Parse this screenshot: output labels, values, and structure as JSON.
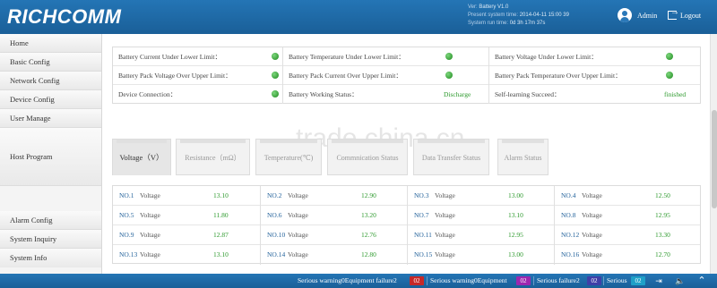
{
  "header": {
    "logo": "RICHCOMM",
    "version_label": "Ver:",
    "version_value": "Battery V1.0",
    "present_time_label": "Present system time:",
    "present_time_value": "2014-04-11 15:00 39",
    "run_time_label": "System run time:",
    "run_time_value": "0d 3h 17m 37s",
    "user_name": "Admin",
    "logout_label": "Logout"
  },
  "sidebar": {
    "items": [
      {
        "label": "Home"
      },
      {
        "label": "Basic Config"
      },
      {
        "label": "Network Config"
      },
      {
        "label": "Device Config"
      },
      {
        "label": "User Manage"
      },
      {
        "label": "Host Program"
      },
      {
        "label": "Alarm Config"
      },
      {
        "label": "System Inquiry"
      },
      {
        "label": "System Info"
      }
    ]
  },
  "status": {
    "rows": [
      [
        {
          "label": "Battery Current Under Lower Limit：",
          "indicator": "green"
        },
        {
          "label": "Battery Temperature Under Lower Limit：",
          "indicator": "green"
        },
        {
          "label": "Battery Voltage Under Lower Limit：",
          "indicator": "green"
        }
      ],
      [
        {
          "label": "Battery Pack Voltage Over Upper Limit：",
          "indicator": "green"
        },
        {
          "label": "Battery Pack Current Over Upper Limit：",
          "indicator": "green"
        },
        {
          "label": "Battery Pack Temperature Over Upper Limit：",
          "indicator": "green"
        }
      ],
      [
        {
          "label": "Device Connection：",
          "indicator": "green"
        },
        {
          "label": "Battery Working Status：",
          "value": "Discharge"
        },
        {
          "label": "Self-learning Succeed：",
          "value": "finished"
        }
      ]
    ]
  },
  "tabs": [
    {
      "label": "Voltage（V）",
      "active": true
    },
    {
      "label": "Resistance（mΩ）",
      "active": false
    },
    {
      "label": "Temperature(℃)",
      "active": false
    },
    {
      "label": "Commnication Status",
      "active": false
    },
    {
      "label": "Data Transfer Status",
      "active": false
    },
    {
      "label": "Alarm Status",
      "active": false
    }
  ],
  "voltages": [
    {
      "no": "NO.1",
      "label": "Voltage",
      "value": "13.10"
    },
    {
      "no": "NO.2",
      "label": "Voltage",
      "value": "12.90"
    },
    {
      "no": "NO.3",
      "label": "Voltage",
      "value": "13.00"
    },
    {
      "no": "NO.4",
      "label": "Voltage",
      "value": "12.50"
    },
    {
      "no": "NO.5",
      "label": "Voltage",
      "value": "11.80"
    },
    {
      "no": "NO.6",
      "label": "Voltage",
      "value": "13.20"
    },
    {
      "no": "NO.7",
      "label": "Voltage",
      "value": "13.10"
    },
    {
      "no": "NO.8",
      "label": "Voltage",
      "value": "12.95"
    },
    {
      "no": "NO.9",
      "label": "Voltage",
      "value": "12.87"
    },
    {
      "no": "NO.10",
      "label": "Voltage",
      "value": "12.76"
    },
    {
      "no": "NO.11",
      "label": "Voltage",
      "value": "12.95"
    },
    {
      "no": "NO.12",
      "label": "Voltage",
      "value": "13.30"
    },
    {
      "no": "NO.13",
      "label": "Voltage",
      "value": "13.10"
    },
    {
      "no": "NO.14",
      "label": "Voltage",
      "value": "12.80"
    },
    {
      "no": "NO.15",
      "label": "Voltage",
      "value": "13.00"
    },
    {
      "no": "NO.16",
      "label": "Voltage",
      "value": "12.70"
    }
  ],
  "watermark": "trade.china.cn",
  "footer": {
    "alarms": [
      {
        "label": "Serious warning0Equipment failure2",
        "count": "02",
        "color": "#c62828"
      },
      {
        "label": "Serious warning0Equipment",
        "count": "02",
        "color": "#9c27b0"
      },
      {
        "label": "Serious failure2",
        "count": "02",
        "color": "#3f3fa8"
      },
      {
        "label": "Serious",
        "count": "02",
        "color": "#1ea0c8"
      }
    ]
  },
  "colors": {
    "header_bg": "#1f6aa8",
    "accent_green": "#2e9a2e",
    "number_blue": "#1f5f99"
  }
}
